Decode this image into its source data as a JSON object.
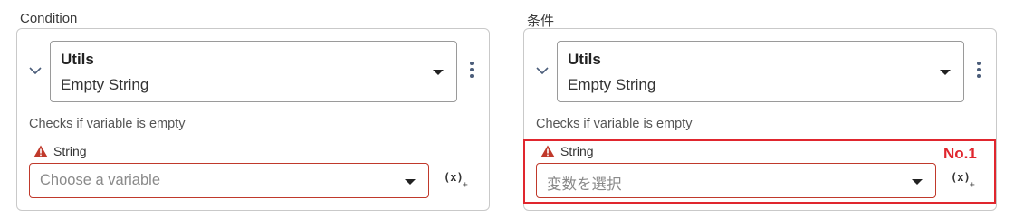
{
  "panels": [
    {
      "title": "Condition",
      "selector": {
        "category": "Utils",
        "action": "Empty String"
      },
      "description": "Checks if variable is empty",
      "field_label": "String",
      "variable_placeholder": "Choose a variable",
      "fx_label": "(x)",
      "fx_sub": "+"
    },
    {
      "title": "条件",
      "selector": {
        "category": "Utils",
        "action": "Empty String"
      },
      "description": "Checks if variable is empty",
      "field_label": "String",
      "variable_placeholder": "変数を選択",
      "fx_label": "(x)",
      "fx_sub": "+"
    }
  ],
  "annotation": {
    "label": "No.1",
    "color": "#e0262e"
  },
  "colors": {
    "error_border": "#c0392b",
    "warning_icon": "#c0392b",
    "kebab": "#4b5d7a",
    "chevron": "#4b5d7a"
  },
  "icons": {
    "chevron": "chevron-down-icon",
    "kebab": "more-vertical-icon",
    "warning": "warning-triangle-icon",
    "caret": "caret-down-icon",
    "variable": "variable-insert-icon"
  }
}
